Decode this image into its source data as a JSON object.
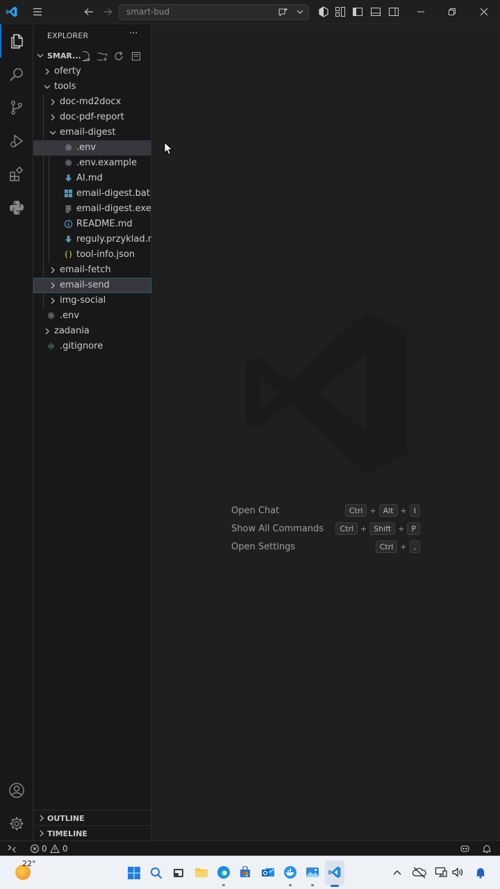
{
  "titlebar": {
    "search_placeholder": "smart-bud"
  },
  "explorer": {
    "header": "EXPLORER",
    "more": "···",
    "root_folder": "SMAR...",
    "items": [
      {
        "label": "oferty",
        "type": "folder",
        "expanded": false
      },
      {
        "label": "tools",
        "type": "folder",
        "expanded": true
      },
      {
        "label": "doc-md2docx",
        "type": "folder",
        "expanded": false
      },
      {
        "label": "doc-pdf-report",
        "type": "folder",
        "expanded": false
      },
      {
        "label": "email-digest",
        "type": "folder",
        "expanded": true
      },
      {
        "label": ".env",
        "type": "file",
        "icon": "gear-icon",
        "selected": true
      },
      {
        "label": ".env.example",
        "type": "file",
        "icon": "gear-icon"
      },
      {
        "label": "AI.md",
        "type": "file",
        "icon": "markdown-download-icon"
      },
      {
        "label": "email-digest.bat",
        "type": "file",
        "icon": "windows-icon"
      },
      {
        "label": "email-digest.exe",
        "type": "file",
        "icon": "lines-icon"
      },
      {
        "label": "README.md",
        "type": "file",
        "icon": "info-icon"
      },
      {
        "label": "reguly.przyklad.md",
        "type": "file",
        "icon": "markdown-download-icon"
      },
      {
        "label": "tool-info.json",
        "type": "file",
        "icon": "json-braces-icon"
      },
      {
        "label": "email-fetch",
        "type": "folder",
        "expanded": false
      },
      {
        "label": "email-send",
        "type": "folder",
        "expanded": false,
        "focused": true
      },
      {
        "label": "img-social",
        "type": "folder",
        "expanded": false
      },
      {
        "label": ".env",
        "type": "file",
        "icon": "gear-icon"
      },
      {
        "label": "zadania",
        "type": "folder",
        "expanded": false
      },
      {
        "label": ".gitignore",
        "type": "file",
        "icon": "git-diamond-icon"
      }
    ],
    "outline_label": "OUTLINE",
    "timeline_label": "TIMELINE"
  },
  "editor": {
    "shortcuts": [
      {
        "label": "Open Chat",
        "keys": [
          "Ctrl",
          "Alt",
          "I"
        ]
      },
      {
        "label": "Show All Commands",
        "keys": [
          "Ctrl",
          "Shift",
          "P"
        ]
      },
      {
        "label": "Open Settings",
        "keys": [
          "Ctrl",
          ","
        ]
      }
    ]
  },
  "statusbar": {
    "errors": "0",
    "warnings": "0"
  },
  "taskbar": {
    "temperature": "22°"
  },
  "colors": {
    "accent": "#0078d4",
    "sidebar_bg": "#181818",
    "editor_bg": "#1f1f1f",
    "selection_bg": "#37373d",
    "taskbar_bg": "#eef1f6"
  }
}
